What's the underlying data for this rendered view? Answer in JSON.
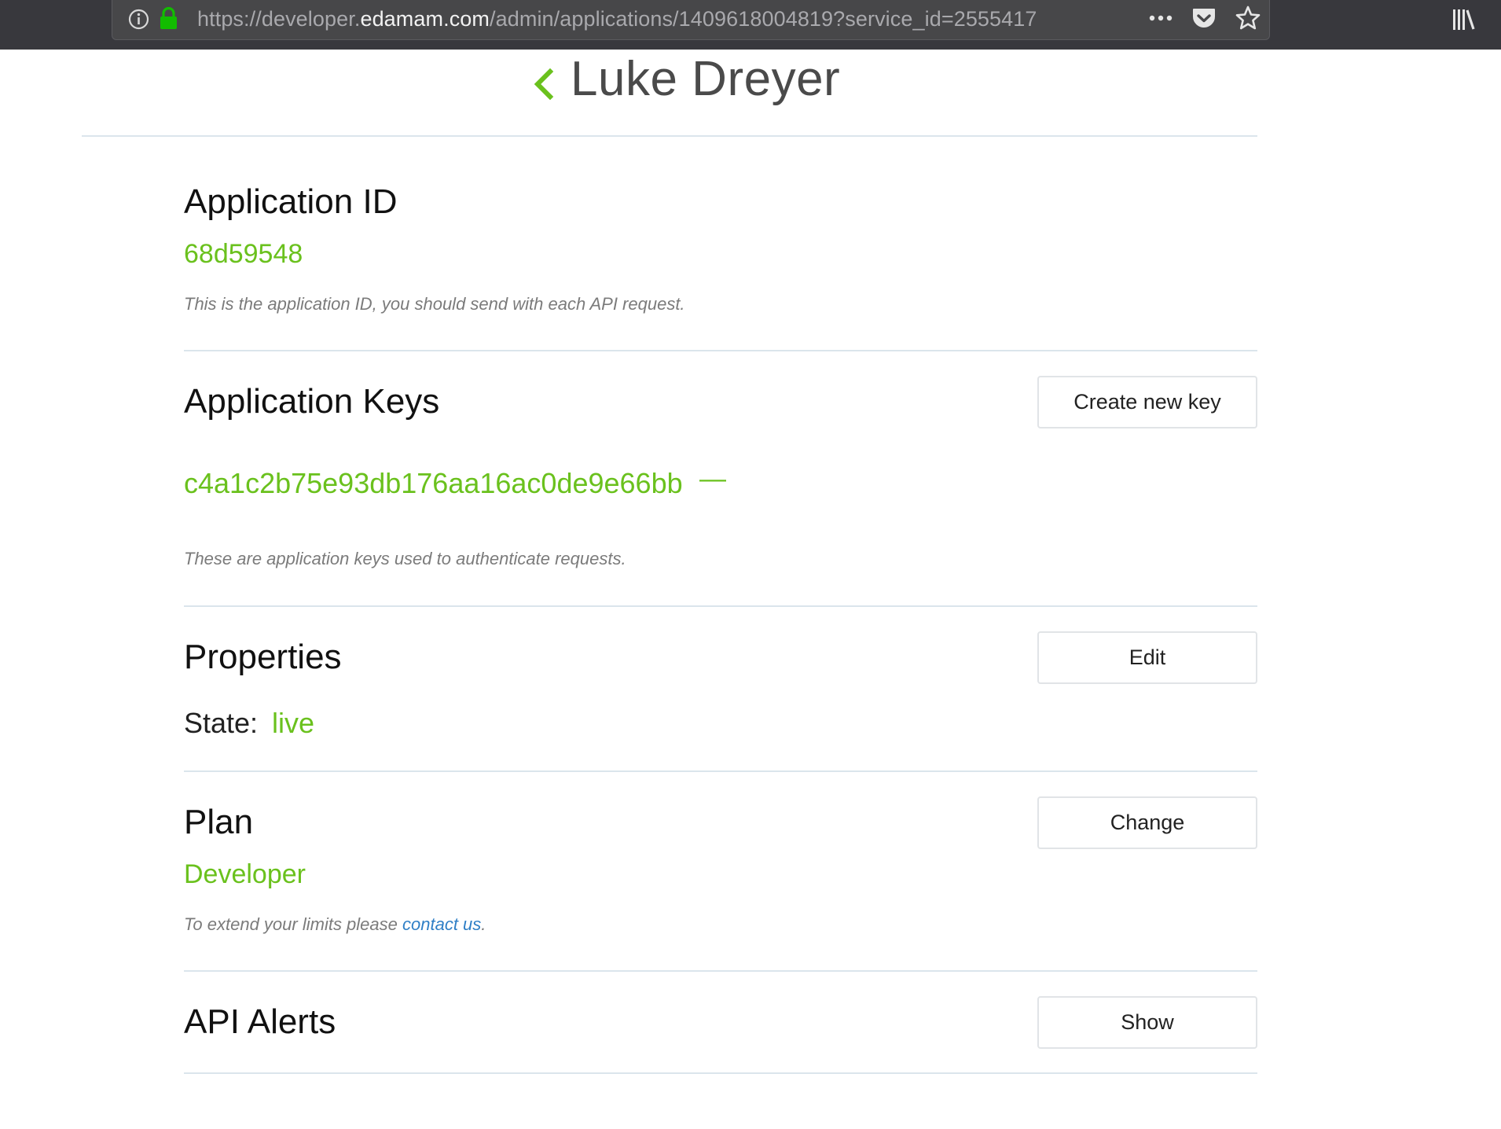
{
  "browser": {
    "url_prefix": "https://developer.",
    "url_host": "edamam.com",
    "url_path": "/admin/applications/1409618004819?service_id=2555417"
  },
  "header": {
    "title": "Luke Dreyer"
  },
  "app_id": {
    "title": "Application ID",
    "value": "68d59548",
    "note": "This is the application ID, you should send with each API request."
  },
  "app_keys": {
    "title": "Application Keys",
    "button": "Create new key",
    "key": "c4a1c2b75e93db176aa16ac0de9e66bb",
    "remove": "—",
    "note": "These are application keys used to authenticate requests."
  },
  "properties": {
    "title": "Properties",
    "button": "Edit",
    "state_label": "State:",
    "state_value": "live"
  },
  "plan": {
    "title": "Plan",
    "button": "Change",
    "value": "Developer",
    "note_prefix": "To extend your limits please ",
    "note_link": "contact us",
    "note_suffix": "."
  },
  "alerts": {
    "title": "API Alerts",
    "button": "Show"
  },
  "colors": {
    "accent_green": "#6ac11d",
    "link_blue": "#2f7fc6",
    "toolbar": "#38383d"
  }
}
